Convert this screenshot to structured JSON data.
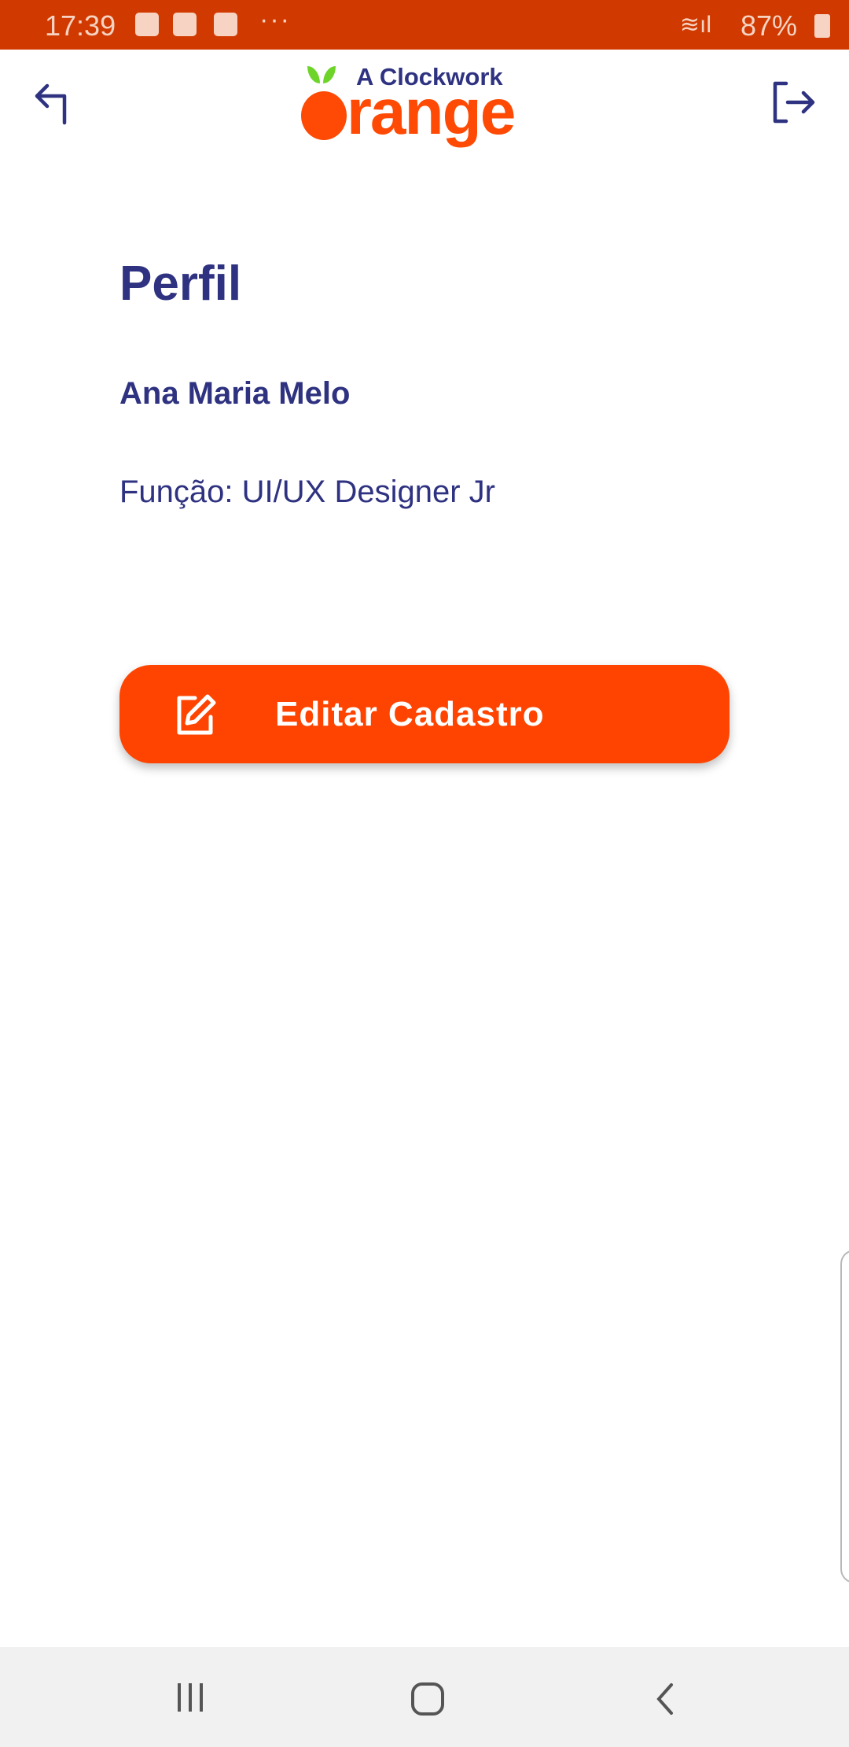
{
  "status_bar": {
    "time": "17:39",
    "battery": "87%",
    "icons": [
      "gallery-icon",
      "sigma-icon",
      "mail-icon",
      "more-icon",
      "wifi-icon",
      "signal-icon",
      "battery-charging-icon"
    ],
    "more": "···"
  },
  "header": {
    "logo_top": "A Clockwork",
    "logo_main": "range",
    "back_icon": "back-arrow-icon",
    "logout_icon": "logout-icon"
  },
  "profile": {
    "title": "Perfil",
    "name": "Ana Maria Melo",
    "role": "Função: UI/UX Designer Jr"
  },
  "edit_button": {
    "label": "Editar Cadastro",
    "icon": "edit-icon"
  },
  "colors": {
    "primary": "#2e3280",
    "accent": "#fe4400",
    "status_bar": "#d03a00"
  }
}
